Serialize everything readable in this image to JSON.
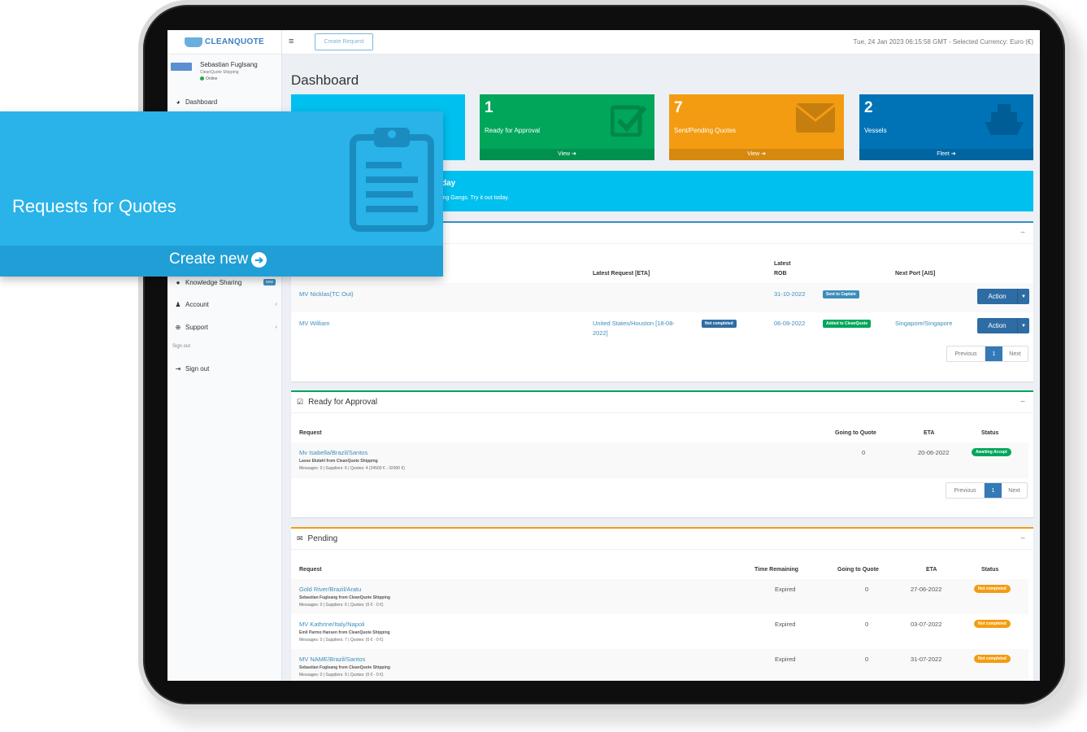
{
  "topbar": {
    "create_request": "Create Request",
    "datetime": "Tue, 24 Jan 2023 06:15:58 GMT - Selected Currency: Euro (€)"
  },
  "logo": {
    "text": "CLEANQUOTE"
  },
  "user": {
    "name": "Sebastian Fuglsang",
    "company": "CleanQuote Shipping",
    "status": "Online"
  },
  "sidebar": {
    "dashboard": "Dashboard",
    "knowledge": "Knowledge Sharing",
    "knowledge_badge": "new",
    "account": "Account",
    "support": "Support",
    "signout_header": "Sign out",
    "signout": "Sign out"
  },
  "page": {
    "title": "Dashboard"
  },
  "boxes": {
    "approval": {
      "num": "1",
      "label": "Ready for Approval",
      "footer": "View",
      "color": "#00a65a"
    },
    "quotes": {
      "num": "7",
      "label": "Sent/Pending Quotes",
      "footer": "View",
      "color": "#f39c12"
    },
    "vessels": {
      "num": "2",
      "label": "Vessels",
      "footer": "Fleet",
      "color": "#0073b7"
    }
  },
  "callout": {
    "title": "day",
    "text": "ing Gangs. Try it out today."
  },
  "rob_panel": {
    "headers": {
      "latest_request": "Latest Request [ETA]",
      "latest_rob_1": "Latest",
      "latest_rob_2": "ROB",
      "next_port": "Next Port [AIS]"
    },
    "rows": [
      {
        "vessel": "MV Nicklas(TC Out)",
        "request": "",
        "req_status": "",
        "rob_date": "31-10-2022",
        "rob_status": "Sent to Captain",
        "port": "",
        "action": "Action"
      },
      {
        "vessel": "MV William",
        "request": "United States/Houston [18-08-",
        "request2": "2022]",
        "req_status": "Not completed",
        "rob_date": "06-09-2022",
        "rob_status": "Added to CleanQuote",
        "port": "Singapore/Singapore",
        "action": "Action"
      }
    ],
    "pager": {
      "prev": "Previous",
      "page": "1",
      "next": "Next"
    }
  },
  "approval_panel": {
    "title": "Ready for Approval",
    "headers": {
      "request": "Request",
      "going": "Going to Quote",
      "eta": "ETA",
      "status": "Status"
    },
    "rows": [
      {
        "request": "Mv Isabella/Brazil/Santos",
        "by": "Lasse Ekdahl from CleanQuote Shipping",
        "meta": "Messages: 0  |  Suppliers: 6  |  Quotes: 4 (24500 € - 32000 €)",
        "going": "0",
        "eta": "20-06-2022",
        "status": "Awaiting Accept"
      }
    ],
    "pager": {
      "prev": "Previous",
      "page": "1",
      "next": "Next"
    }
  },
  "pending_panel": {
    "title": "Pending",
    "headers": {
      "request": "Request",
      "time": "Time Remaining",
      "going": "Going to Quote",
      "eta": "ETA",
      "status": "Status"
    },
    "rows": [
      {
        "request": "Gold River/Brazil/Aratu",
        "by": "Sebastian Fuglsang from CleanQuote Shipping",
        "meta": "Messages: 0  |  Suppliers: 6  |  Quotes: (0 € - 0 €)",
        "time": "Expired",
        "going": "0",
        "eta": "27-06-2022",
        "status": "Not completed"
      },
      {
        "request": "MV Kathrine/Italy/Napoli",
        "by": "Emil Parmo Hansen from CleanQuote Shipping",
        "meta": "Messages: 0  |  Suppliers: 7  |  Quotes: (0 € - 0 €)",
        "time": "Expired",
        "going": "0",
        "eta": "03-07-2022",
        "status": "Not completed"
      },
      {
        "request": "MV NAME/Brazil/Santos",
        "by": "Sebastian Fuglsang from CleanQuote Shipping",
        "meta": "Messages: 0  |  Suppliers: 9  |  Quotes: (0 € - 0 €)",
        "time": "Expired",
        "going": "0",
        "eta": "31-07-2022",
        "status": "Not completed"
      }
    ]
  },
  "rfq_card": {
    "title": "Requests for Quotes",
    "create": "Create new"
  },
  "colors": {
    "primary": "#3c8dbc",
    "aqua": "#00c0ef",
    "green": "#00a65a",
    "orange": "#f39c12",
    "blue": "#0073b7",
    "card": "#29b3e8"
  }
}
